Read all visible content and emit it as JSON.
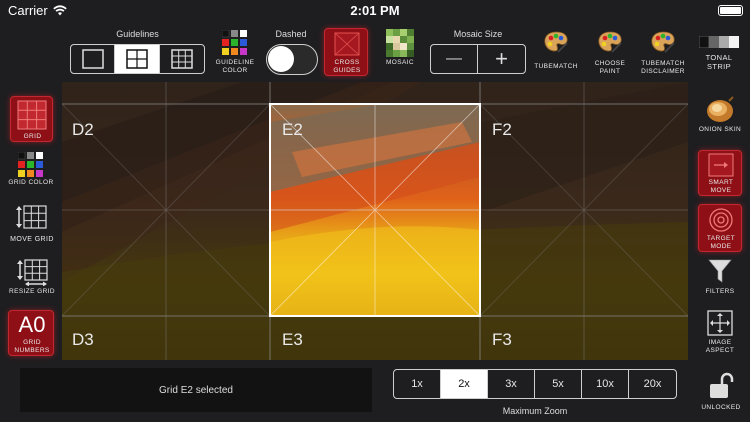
{
  "status": {
    "carrier": "Carrier",
    "time": "2:01 PM"
  },
  "toolbar": {
    "guidelines_label": "Guidelines",
    "guideline_color_label": "Guideline Color",
    "dashed_label": "Dashed",
    "cross_guides_label": "Cross Guides",
    "mosaic_label": "Mosaic",
    "mosaic_size_label": "Mosaic Size",
    "minus": "—",
    "plus": "+",
    "tubematch_label": "TubeMatch",
    "choose_paint_label": "Choose Paint",
    "tubematch_disclaimer_label": "TubeMatch Disclaimer",
    "tonal_strip_label": "Tonal Strip",
    "guidelines_selected": 1
  },
  "left_sidebar": {
    "grid_label": "Grid",
    "grid_color_label": "Grid Color",
    "move_grid_label": "Move Grid",
    "resize_grid_label": "Resize Grid",
    "grid_numbers_glyph": "A0",
    "grid_numbers_label": "Grid Numbers"
  },
  "right_sidebar": {
    "onion_skin_label": "Onion Skin",
    "smart_move_label": "Smart Move",
    "target_mode_label": "Target Mode",
    "filters_label": "Filters",
    "image_aspect_label": "Image Aspect",
    "unlocked_label": "Unlocked"
  },
  "grid": {
    "cells": [
      "D2",
      "E2",
      "F2",
      "D3",
      "E3",
      "F3"
    ],
    "selected_cell": "E2"
  },
  "message": "Grid E2 selected",
  "zoom": {
    "options": [
      "1x",
      "2x",
      "3x",
      "5x",
      "10x",
      "20x"
    ],
    "selected": "2x",
    "label": "Maximum Zoom"
  },
  "colors": {
    "accent_red": "#8e1016",
    "background": "#1e1e20"
  }
}
